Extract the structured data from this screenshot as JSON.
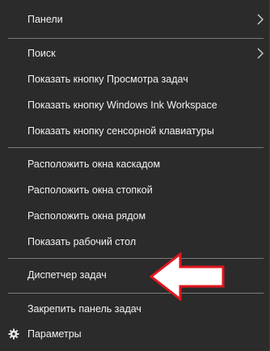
{
  "menu": {
    "panels": {
      "label": "Панели",
      "icon": "chevron-right-icon"
    },
    "search": {
      "label": "Поиск",
      "icon": "chevron-right-icon"
    },
    "show_task_view": {
      "label": "Показать кнопку Просмотра задач"
    },
    "show_ink": {
      "label": "Показать кнопку Windows Ink Workspace"
    },
    "show_keyboard": {
      "label": "Показать кнопку сенсорной клавиатуры"
    },
    "cascade": {
      "label": "Расположить окна каскадом"
    },
    "stack": {
      "label": "Расположить окна стопкой"
    },
    "side_by_side": {
      "label": "Расположить окна рядом"
    },
    "show_desktop": {
      "label": "Показать рабочий стол"
    },
    "task_manager": {
      "label": "Диспетчер задач"
    },
    "lock_taskbar": {
      "label": "Закрепить панель задач"
    },
    "settings": {
      "label": "Параметры",
      "icon": "gear-icon"
    }
  },
  "annotation": {
    "icon": "red-arrow-left-icon",
    "color": "#e0161e"
  }
}
